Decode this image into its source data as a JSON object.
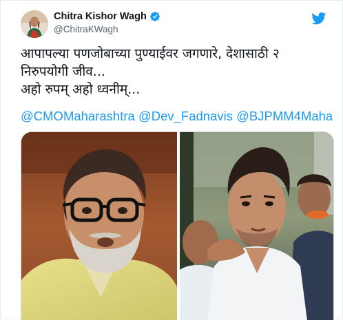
{
  "author": {
    "display_name": "Chitra Kishor Wagh",
    "handle": "@ChitraKWagh",
    "verified": true,
    "avatar_icon": "profile-photo-avatar"
  },
  "tweet": {
    "text": "आपापल्या पणजोबाच्या पुण्याईवर जगणारे, देशासाठी २\nनिरुपयोगी जीव...\nअहो रुपम् अहो ध्वनीम्...",
    "mentions": [
      "@CMOMaharashtra",
      "@Dev_Fadnavis",
      "@BJPMM4Maha"
    ]
  },
  "icons": {
    "brand": "twitter-bird-icon",
    "verified": "verified-badge-icon"
  },
  "colors": {
    "link": "#1d9bf0",
    "text": "#0f1419",
    "muted": "#536471",
    "border": "#cfd9de"
  },
  "media": {
    "photos": [
      "photo-left",
      "photo-right"
    ]
  }
}
